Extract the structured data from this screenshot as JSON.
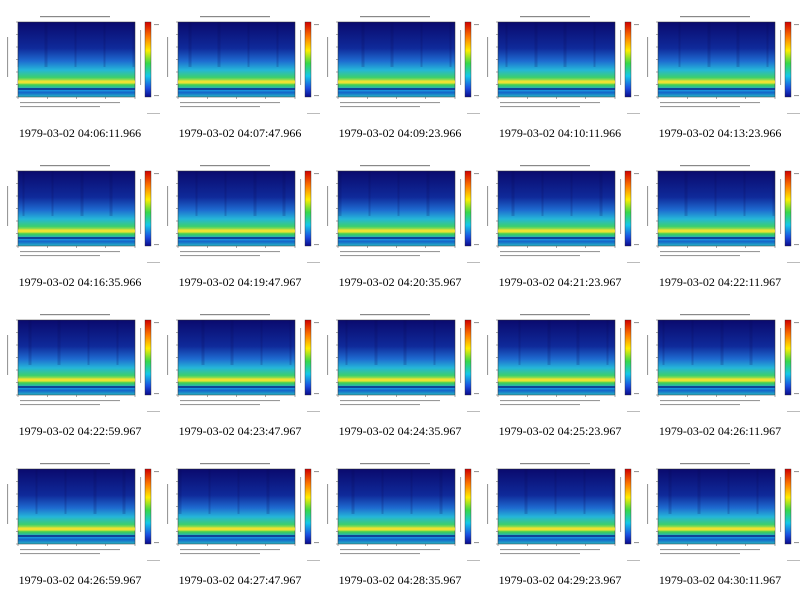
{
  "gallery": {
    "panels": [
      {
        "caption": "1979-03-02 04:06:11.966"
      },
      {
        "caption": "1979-03-02 04:07:47.966"
      },
      {
        "caption": "1979-03-02 04:09:23.966"
      },
      {
        "caption": "1979-03-02 04:10:11.966"
      },
      {
        "caption": "1979-03-02 04:13:23.966"
      },
      {
        "caption": "1979-03-02 04:16:35.966"
      },
      {
        "caption": "1979-03-02 04:19:47.967"
      },
      {
        "caption": "1979-03-02 04:20:35.967"
      },
      {
        "caption": "1979-03-02 04:21:23.967"
      },
      {
        "caption": "1979-03-02 04:22:11.967"
      },
      {
        "caption": "1979-03-02 04:22:59.967"
      },
      {
        "caption": "1979-03-02 04:23:47.967"
      },
      {
        "caption": "1979-03-02 04:24:35.967"
      },
      {
        "caption": "1979-03-02 04:25:23.967"
      },
      {
        "caption": "1979-03-02 04:26:11.967"
      },
      {
        "caption": "1979-03-02 04:26:59.967"
      },
      {
        "caption": "1979-03-02 04:27:47.967"
      },
      {
        "caption": "1979-03-02 04:28:35.967"
      },
      {
        "caption": "1979-03-02 04:29:23.967"
      },
      {
        "caption": "1979-03-02 04:30:11.967"
      }
    ]
  }
}
